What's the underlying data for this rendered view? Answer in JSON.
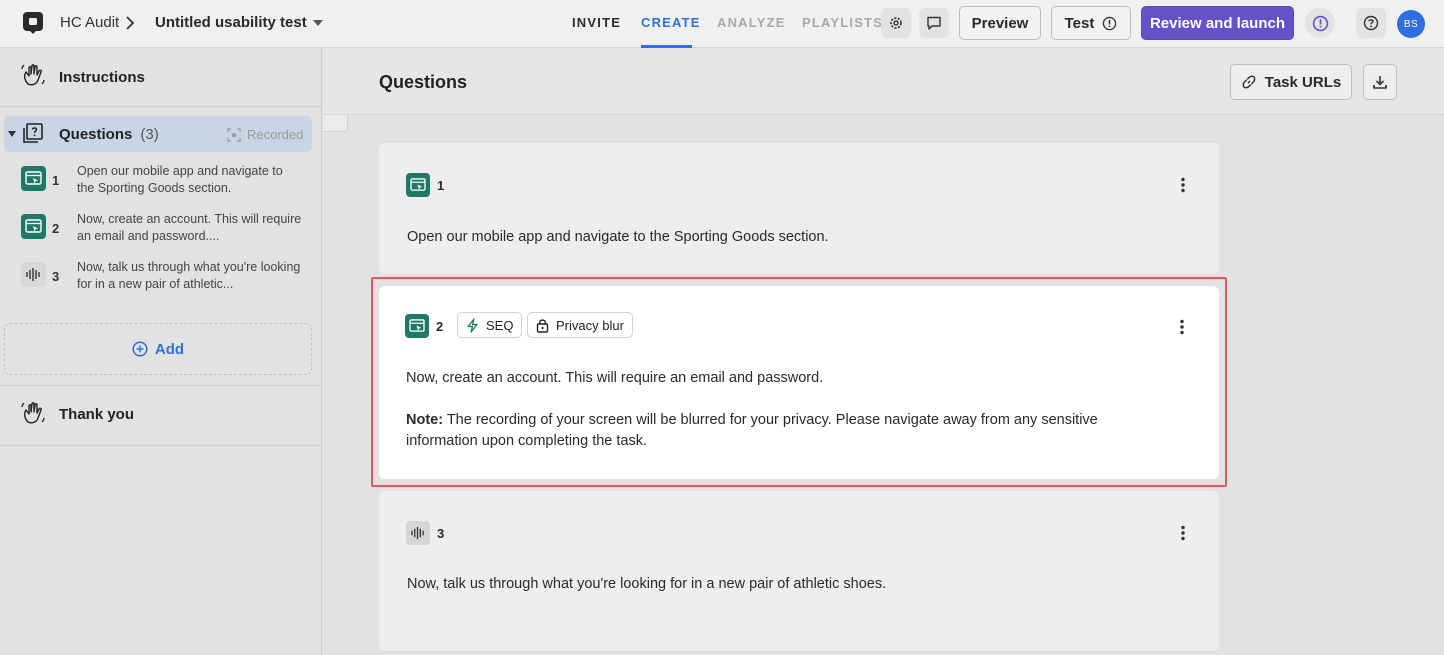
{
  "topbar": {
    "project": "HC Audit",
    "test_name": "Untitled usability test",
    "tabs": [
      {
        "label": "INVITE",
        "state": "normal"
      },
      {
        "label": "CREATE",
        "state": "active"
      },
      {
        "label": "ANALYZE",
        "state": "muted"
      },
      {
        "label": "PLAYLISTS",
        "state": "muted"
      }
    ],
    "preview_label": "Preview",
    "test_label": "Test",
    "launch_label": "Review and launch",
    "avatar_initials": "BS"
  },
  "sidebar": {
    "instructions_label": "Instructions",
    "questions_label": "Questions",
    "questions_count": "(3)",
    "recorded_label": "Recorded",
    "items": [
      {
        "num": "1",
        "type": "task",
        "text": "Open our mobile app and navigate to the Sporting Goods section."
      },
      {
        "num": "2",
        "type": "task",
        "text": "Now, create an account. This will require an email and password...."
      },
      {
        "num": "3",
        "type": "audio",
        "text": "Now, talk us through what you're looking for in a new pair of athletic..."
      }
    ],
    "add_label": "Add",
    "thankyou_label": "Thank you"
  },
  "main": {
    "title": "Questions",
    "task_urls_label": "Task URLs",
    "cards": [
      {
        "num": "1",
        "type": "task",
        "text": "Open our mobile app and navigate to the Sporting Goods section."
      },
      {
        "num": "2",
        "type": "task",
        "chips": [
          "SEQ",
          "Privacy blur"
        ],
        "text": "Now, create an account. This will require an email and password.",
        "note_label": "Note:",
        "note_text": " The recording of your screen will be blurred for your privacy. Please navigate away from any sensitive information upon completing the task."
      },
      {
        "num": "3",
        "type": "audio",
        "text": "Now, talk us through what you're looking for in a new pair of athletic shoes."
      }
    ]
  },
  "colors": {
    "accent": "#2f6fe0",
    "launch": "#6552c8",
    "task_icon": "#1e7a66",
    "highlight": "#e0595b"
  }
}
